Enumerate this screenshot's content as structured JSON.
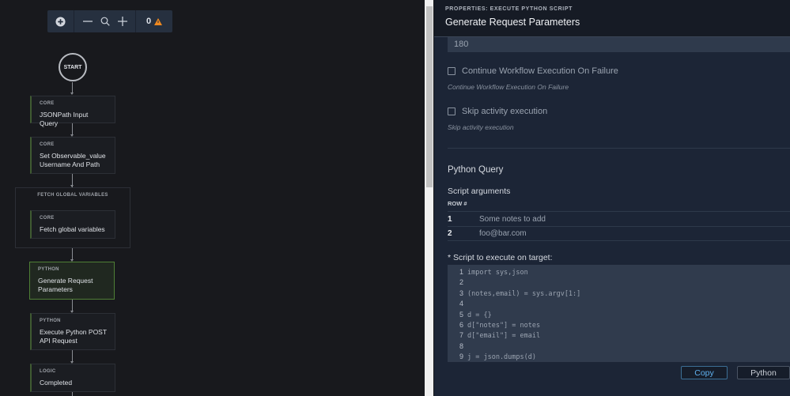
{
  "canvas": {
    "toolbar": {
      "add_icon": "plus-circle-icon",
      "zoom_out_icon": "minus-icon",
      "zoom_icon": "magnifier-icon",
      "zoom_in_icon": "plus-icon",
      "warning_count": "0",
      "warning_icon": "warning-triangle-icon",
      "warning_color": "#f0891f"
    },
    "start_label": "START",
    "nodes": [
      {
        "category": "CORE",
        "name": "JSONPath Input Query"
      },
      {
        "category": "CORE",
        "name": "Set Observable_value Username And Path"
      },
      {
        "category": "CORE",
        "name": "Fetch global variables"
      },
      {
        "category": "PYTHON",
        "name": "Generate Request Parameters",
        "selected": true
      },
      {
        "category": "PYTHON",
        "name": "Execute Python POST API Request"
      },
      {
        "category": "LOGIC",
        "name": "Completed"
      }
    ],
    "group_title": "FETCH GLOBAL VARIABLES",
    "selected_color": "#4f7f35"
  },
  "panel": {
    "subtitle": "PROPERTIES: EXECUTE PYTHON SCRIPT",
    "title": "Generate Request Parameters",
    "timeout_value": "180",
    "continue_on_failure": {
      "label": "Continue Workflow Execution On Failure",
      "hint": "Continue Workflow Execution On Failure",
      "checked": false
    },
    "skip_activity": {
      "label": "Skip activity execution",
      "hint": "Skip activity execution",
      "checked": false
    },
    "section_title": "Python Query",
    "args_label": "Script arguments",
    "args_header": "ROW #",
    "args": [
      {
        "row": "1",
        "value": "Some notes to add"
      },
      {
        "row": "2",
        "value": "foo@bar.com"
      }
    ],
    "script_label": "* Script to execute on target:",
    "script_lines": [
      {
        "n": "1",
        "code": "import sys,json"
      },
      {
        "n": "2",
        "code": ""
      },
      {
        "n": "3",
        "code": "(notes,email) = sys.argv[1:]"
      },
      {
        "n": "4",
        "code": ""
      },
      {
        "n": "5",
        "code": "d = {}"
      },
      {
        "n": "6",
        "code": "d[\"notes\"] = notes"
      },
      {
        "n": "7",
        "code": "d[\"email\"] = email"
      },
      {
        "n": "8",
        "code": ""
      },
      {
        "n": "9",
        "code": "j = json.dumps(d)"
      }
    ],
    "copy_label": "Copy",
    "language_label": "Python"
  }
}
